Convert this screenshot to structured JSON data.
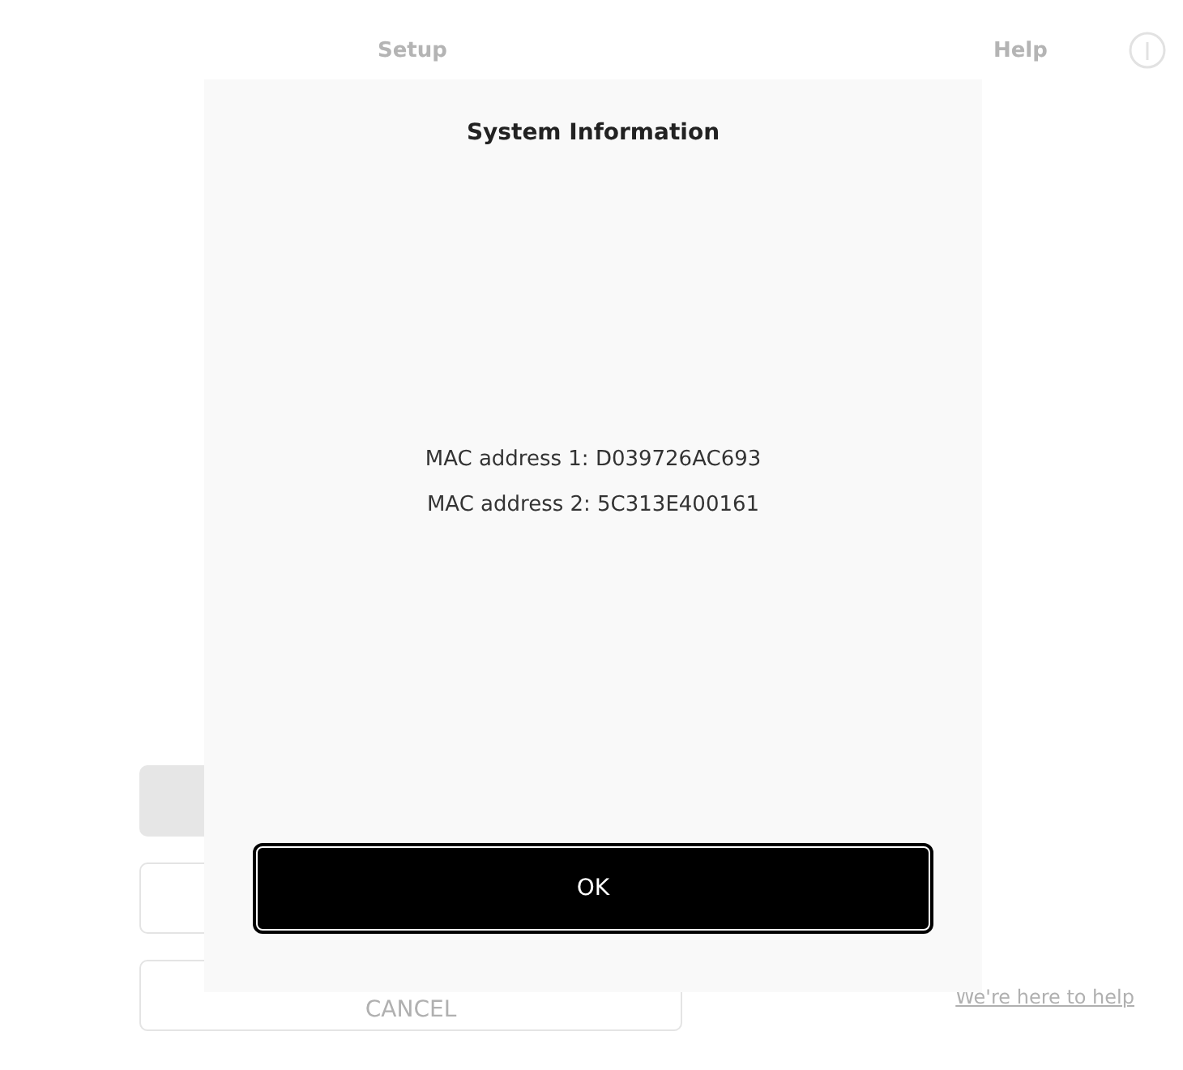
{
  "header": {
    "setup_label": "Setup",
    "help_label": "Help"
  },
  "background_buttons": [
    {
      "kind": "filled"
    },
    {
      "kind": "outlined"
    },
    {
      "kind": "outlined",
      "label": "CANCEL"
    }
  ],
  "help_link": "We're here to help",
  "dialog": {
    "title": "System Information",
    "lines": [
      "MAC address 1: D039726AC693",
      "MAC address 2: 5C313E400161"
    ],
    "button": "OK"
  }
}
